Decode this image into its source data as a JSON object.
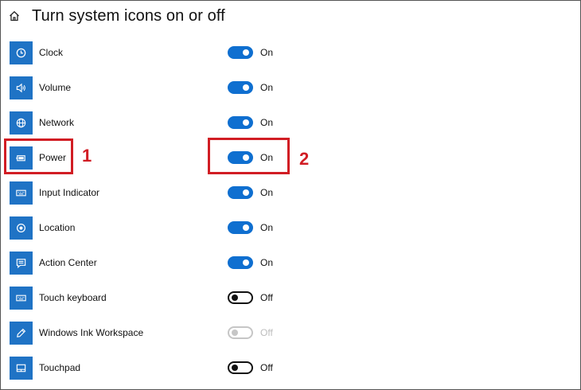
{
  "header": {
    "title": "Turn system icons on or off"
  },
  "items": [
    {
      "label": "Clock",
      "icon": "clock-icon",
      "state": "On",
      "enabled": true
    },
    {
      "label": "Volume",
      "icon": "volume-icon",
      "state": "On",
      "enabled": true
    },
    {
      "label": "Network",
      "icon": "network-icon",
      "state": "On",
      "enabled": true
    },
    {
      "label": "Power",
      "icon": "battery-icon",
      "state": "On",
      "enabled": true
    },
    {
      "label": "Input Indicator",
      "icon": "keyboard-icon",
      "state": "On",
      "enabled": true
    },
    {
      "label": "Location",
      "icon": "location-icon",
      "state": "On",
      "enabled": true
    },
    {
      "label": "Action Center",
      "icon": "action-center-icon",
      "state": "On",
      "enabled": true
    },
    {
      "label": "Touch keyboard",
      "icon": "keyboard-icon",
      "state": "Off",
      "enabled": true
    },
    {
      "label": "Windows Ink Workspace",
      "icon": "pen-icon",
      "state": "Off",
      "enabled": false
    },
    {
      "label": "Touchpad",
      "icon": "touchpad-icon",
      "state": "Off",
      "enabled": true
    }
  ],
  "annotations": [
    {
      "number": "1"
    },
    {
      "number": "2"
    }
  ],
  "colors": {
    "accent": "#0f6fd0",
    "tile": "#1f73c5",
    "callout": "#d11d24"
  }
}
